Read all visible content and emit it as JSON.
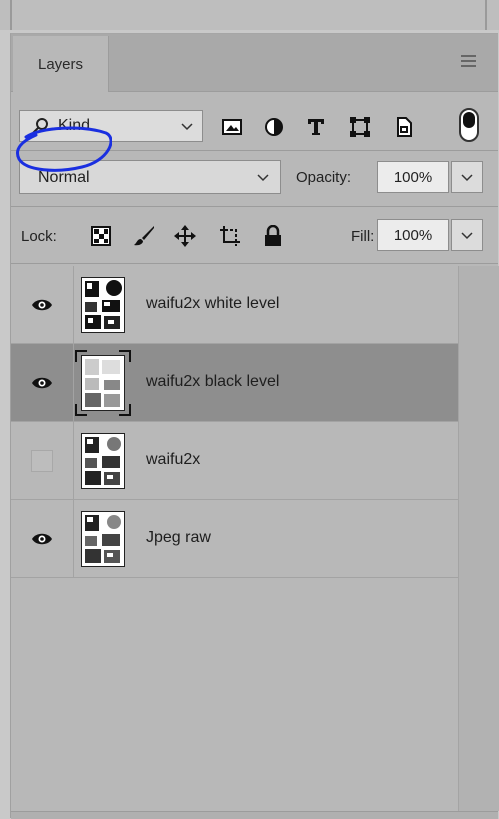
{
  "panel": {
    "tab_label": "Layers"
  },
  "filter": {
    "kind_label": "Kind",
    "icons": [
      "pixel-layer-filter-icon",
      "adjustment-layer-filter-icon",
      "type-layer-filter-icon",
      "shape-layer-filter-icon",
      "smart-object-filter-icon"
    ]
  },
  "blend": {
    "mode": "Normal",
    "opacity_label": "Opacity:",
    "opacity_value": "100%"
  },
  "lock": {
    "label": "Lock:",
    "fill_label": "Fill:",
    "fill_value": "100%"
  },
  "layers": [
    {
      "name": "waifu2x white level",
      "visible": true,
      "selected": false
    },
    {
      "name": "waifu2x black level",
      "visible": true,
      "selected": true
    },
    {
      "name": "waifu2x",
      "visible": false,
      "selected": false
    },
    {
      "name": "Jpeg raw",
      "visible": true,
      "selected": false
    }
  ],
  "colors": {
    "annotation_circle": "#1a2fe0",
    "selected_row": "#8e8e8e",
    "panel_bg": "#b8b8b8"
  }
}
